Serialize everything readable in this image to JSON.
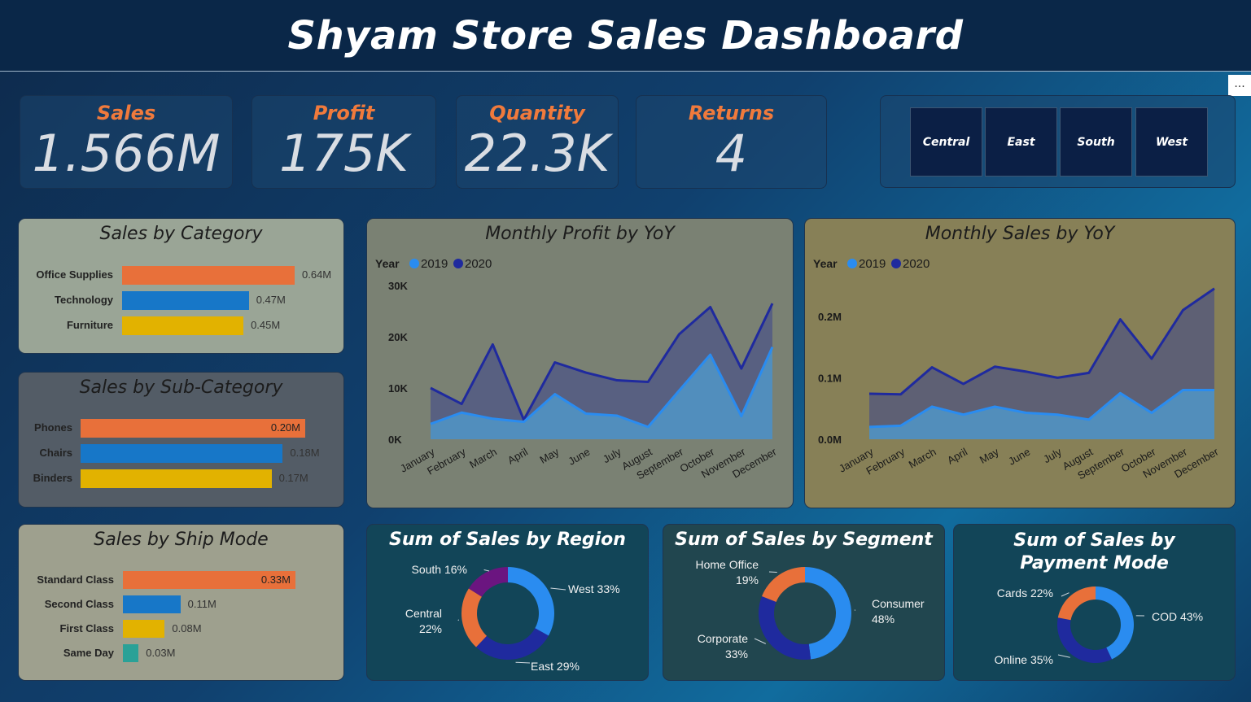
{
  "title": "Shyam Store Sales Dashboard",
  "more_icon": "...",
  "kpis": [
    {
      "label": "Sales",
      "value": "1.566M"
    },
    {
      "label": "Profit",
      "value": "175K"
    },
    {
      "label": "Quantity",
      "value": "22.3K"
    },
    {
      "label": "Returns",
      "value": "4"
    }
  ],
  "region_slicer": [
    "Central",
    "East",
    "South",
    "West"
  ],
  "colors": {
    "orange": "#e8703a",
    "blue": "#1777c8",
    "yellow": "#e2b200",
    "teal": "#2aa197",
    "year2019": "#2a8cf0",
    "year2020": "#1f2a9e",
    "purple": "#6b1580",
    "navy": "#1f2a9e"
  },
  "category": {
    "title": "Sales by Category",
    "items": [
      {
        "label": "Office Supplies",
        "value": 0.64,
        "text": "0.64M"
      },
      {
        "label": "Technology",
        "value": 0.47,
        "text": "0.47M"
      },
      {
        "label": "Furniture",
        "value": 0.45,
        "text": "0.45M"
      }
    ]
  },
  "subcategory": {
    "title": "Sales by Sub-Category",
    "items": [
      {
        "label": "Phones",
        "value": 0.2,
        "text": "0.20M"
      },
      {
        "label": "Chairs",
        "value": 0.18,
        "text": "0.18M"
      },
      {
        "label": "Binders",
        "value": 0.17,
        "text": "0.17M"
      }
    ]
  },
  "shipmode": {
    "title": "Sales by Ship Mode",
    "items": [
      {
        "label": "Standard Class",
        "value": 0.33,
        "text": "0.33M"
      },
      {
        "label": "Second Class",
        "value": 0.11,
        "text": "0.11M"
      },
      {
        "label": "First Class",
        "value": 0.08,
        "text": "0.08M"
      },
      {
        "label": "Same Day",
        "value": 0.03,
        "text": "0.03M"
      }
    ]
  },
  "chart_data": [
    {
      "type": "area",
      "title": "Monthly Profit by YoY",
      "legend_title": "Year",
      "x": [
        "January",
        "February",
        "March",
        "April",
        "May",
        "June",
        "July",
        "August",
        "September",
        "October",
        "November",
        "December"
      ],
      "y_ticks": [
        "0K",
        "10K",
        "20K",
        "30K"
      ],
      "ylim": [
        0,
        30000
      ],
      "series": [
        {
          "name": "2019",
          "values": [
            3000,
            5200,
            4000,
            3400,
            8800,
            5000,
            4600,
            2400,
            9500,
            16500,
            4500,
            18000
          ]
        },
        {
          "name": "2020",
          "values": [
            10000,
            6900,
            18500,
            3800,
            15000,
            13000,
            11500,
            11200,
            20500,
            25800,
            13800,
            26500
          ]
        }
      ]
    },
    {
      "type": "area",
      "title": "Monthly Sales by YoY",
      "legend_title": "Year",
      "x": [
        "January",
        "February",
        "March",
        "April",
        "May",
        "June",
        "July",
        "August",
        "September",
        "October",
        "November",
        "December"
      ],
      "y_ticks": [
        "0.0M",
        "0.1M",
        "0.2M"
      ],
      "ylim": [
        0,
        0.25
      ],
      "series": [
        {
          "name": "2019",
          "values": [
            0.02,
            0.022,
            0.053,
            0.04,
            0.053,
            0.043,
            0.04,
            0.032,
            0.075,
            0.043,
            0.08,
            0.08
          ]
        },
        {
          "name": "2020",
          "values": [
            0.074,
            0.073,
            0.117,
            0.09,
            0.118,
            0.11,
            0.1,
            0.108,
            0.195,
            0.131,
            0.21,
            0.245
          ]
        }
      ]
    },
    {
      "type": "pie",
      "title": "Sum of Sales by Region",
      "slices": [
        {
          "name": "West",
          "value": 33,
          "label": "West 33%"
        },
        {
          "name": "East",
          "value": 29,
          "label": "East 29%"
        },
        {
          "name": "Central",
          "value": 22,
          "label": "Central 22%"
        },
        {
          "name": "South",
          "value": 16,
          "label": "South 16%"
        }
      ]
    },
    {
      "type": "pie",
      "title": "Sum of Sales by Segment",
      "slices": [
        {
          "name": "Consumer",
          "value": 48,
          "label": "Consumer 48%"
        },
        {
          "name": "Corporate",
          "value": 33,
          "label": "Corporate 33%"
        },
        {
          "name": "Home Office",
          "value": 19,
          "label": "Home Office 19%"
        }
      ]
    },
    {
      "type": "pie",
      "title": "Sum of Sales by Payment Mode",
      "slices": [
        {
          "name": "COD",
          "value": 43,
          "label": "COD 43%"
        },
        {
          "name": "Online",
          "value": 35,
          "label": "Online 35%"
        },
        {
          "name": "Cards",
          "value": 22,
          "label": "Cards 22%"
        }
      ]
    }
  ]
}
